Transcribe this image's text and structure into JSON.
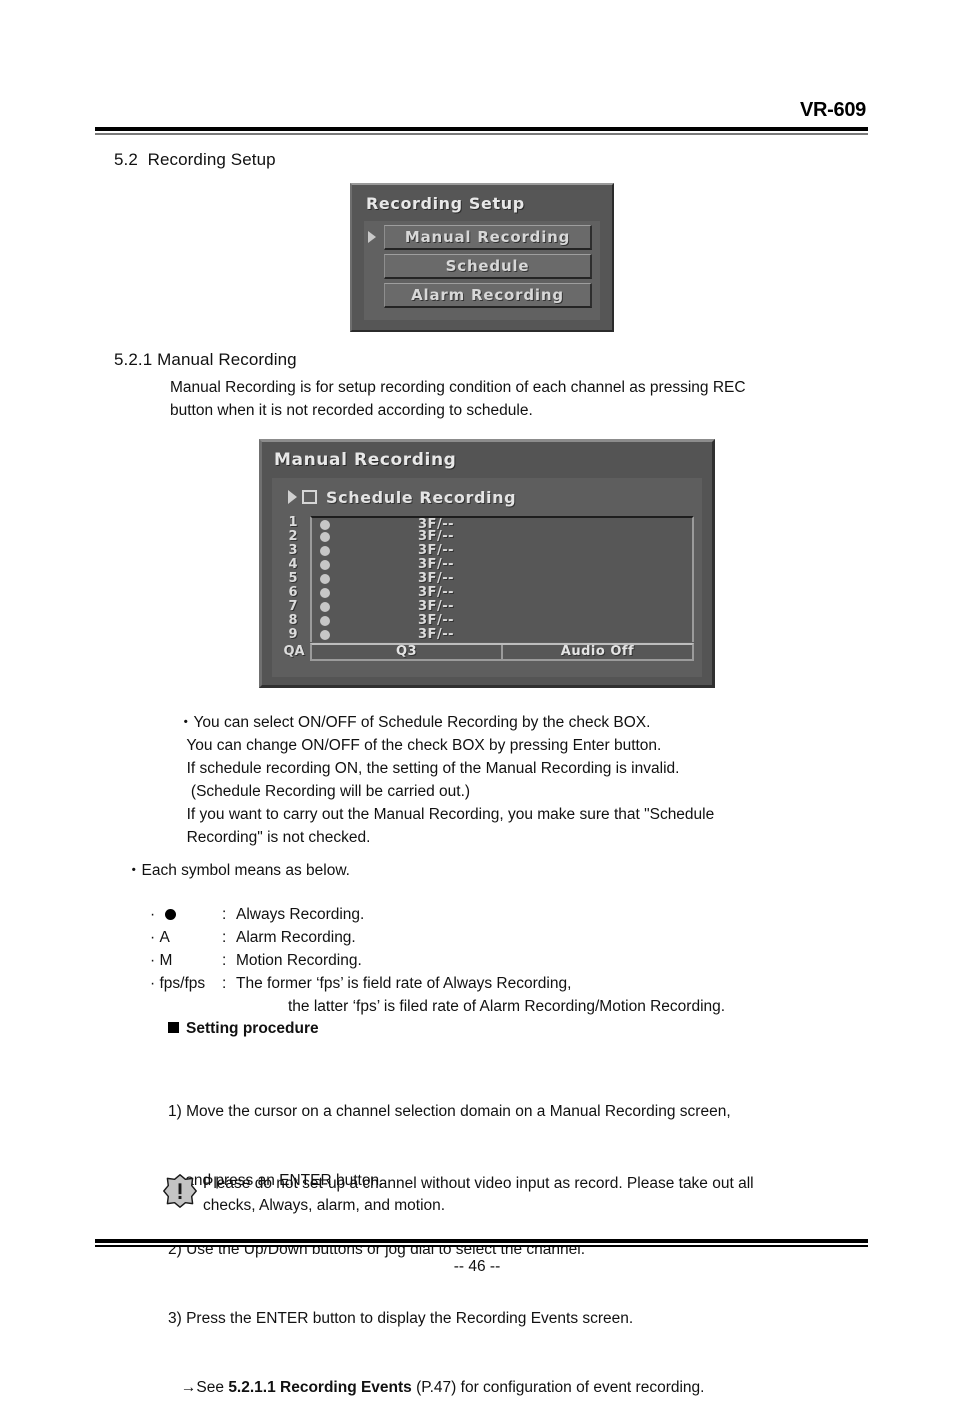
{
  "header": {
    "model": "VR-609"
  },
  "sections": {
    "s52_heading": "5.2  Recording Setup",
    "s521_heading": "5.2.1 Manual Recording",
    "s521_intro": "Manual Recording is for setup recording condition of each channel as pressing REC\nbutton when it is not recorded according to schedule."
  },
  "recording_setup_menu": {
    "title": "Recording Setup",
    "cursor_icon": "right-triangle-cursor",
    "items": [
      {
        "label": "Manual Recording",
        "selected": true
      },
      {
        "label": "Schedule",
        "selected": false
      },
      {
        "label": "Alarm Recording",
        "selected": false
      }
    ]
  },
  "manual_recording_screen": {
    "title": "Manual Recording",
    "cursor_icon": "right-triangle-cursor",
    "checkbox_icon": "unchecked-box",
    "schedule_recording_label": "Schedule Recording",
    "schedule_recording_checked": false,
    "channels": [
      {
        "no": "1",
        "symbol_icon": "filled-circle",
        "rate": "3F/--"
      },
      {
        "no": "2",
        "symbol_icon": "filled-circle",
        "rate": "3F/--"
      },
      {
        "no": "3",
        "symbol_icon": "filled-circle",
        "rate": "3F/--"
      },
      {
        "no": "4",
        "symbol_icon": "filled-circle",
        "rate": "3F/--"
      },
      {
        "no": "5",
        "symbol_icon": "filled-circle",
        "rate": "3F/--"
      },
      {
        "no": "6",
        "symbol_icon": "filled-circle",
        "rate": "3F/--"
      },
      {
        "no": "7",
        "symbol_icon": "filled-circle",
        "rate": "3F/--"
      },
      {
        "no": "8",
        "symbol_icon": "filled-circle",
        "rate": "3F/--"
      },
      {
        "no": "9",
        "symbol_icon": "filled-circle",
        "rate": "3F/--"
      }
    ],
    "qa_row": {
      "label": "QA",
      "quality": "Q3",
      "audio": "Audio Off"
    }
  },
  "notes": {
    "schedule_bullet": "・You can select ON/OFF of Schedule Recording by the check BOX.\n  You can change ON/OFF of the check BOX by pressing Enter button.\n  If schedule recording ON, the setting of the Manual Recording is invalid.\n   (Schedule Recording will be carried out.)\n  If you want to carry out the Manual Recording, you make sure that \"Schedule\n  Recording\" is not checked.",
    "symbol_bullet": "・Each symbol means as below."
  },
  "symbol_legend": [
    {
      "key_icon": "filled-circle",
      "key": "",
      "sep": ":",
      "desc": "Always Recording."
    },
    {
      "key_icon": "",
      "key": "A",
      "sep": ":",
      "desc": "Alarm Recording."
    },
    {
      "key_icon": "",
      "key": "M",
      "sep": ":",
      "desc": "Motion Recording."
    },
    {
      "key_icon": "",
      "key": "fps/fps",
      "sep": ":",
      "desc": "The former ‘fps’ is field rate of Always Recording,"
    }
  ],
  "symbol_legend_cont": "the latter ‘fps’ is filed rate of Alarm Recording/Motion Recording.",
  "setting_procedure": {
    "heading": "Setting procedure",
    "bullet_icon": "filled-square",
    "steps_line1": "1) Move the cursor on a channel selection domain on a Manual Recording screen,",
    "steps_line2": "    and press an ENTER button.",
    "steps_line3": "2) Use the Up/Down buttons or jog dial to select the channel.",
    "steps_line4": "3) Press the ENTER button to display the Recording Events screen.",
    "steps_line5_pre": "   →See ",
    "steps_line5_bold": "5.2.1.1 Recording Events",
    "steps_line5_post": " (P.47) for configuration of event recording."
  },
  "warning": {
    "icon": "exclamation-burst-icon",
    "text": "Please do not set-up a channel without video input as record. Please take out all\nchecks, Always, alarm, and motion."
  },
  "footer": {
    "page_number": "-- 46 --"
  }
}
